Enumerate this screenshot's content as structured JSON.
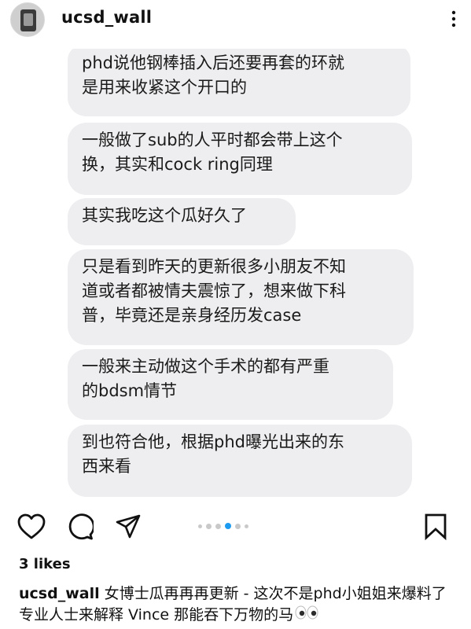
{
  "header": {
    "username": "ucsd_wall",
    "more_icon": "more-vertical-icon"
  },
  "post": {
    "messages": [
      {
        "text_line1": "phd说他钢棒插入后还要再套的环就",
        "text_line2": "是用来收紧这个开口的"
      },
      {
        "text_line1": "一般做了sub的人平时都会带上这个",
        "text_line2": "换，其实和cock ring同理"
      },
      {
        "text_line1": "其实我吃这个瓜好久了",
        "text_line2": ""
      },
      {
        "text_line1": "只是看到昨天的更新很多小朋友不知",
        "text_line2": "道或者都被情夫震惊了，想来做下科",
        "text_line3": "普，毕竟还是亲身经历发case"
      },
      {
        "text_line1": "一般来主动做这个手术的都有严重",
        "text_line2": "的bdsm情节"
      },
      {
        "text_line1": "到也符合他，根据phd曝光出来的东",
        "text_line2": "西来看"
      }
    ]
  },
  "actions": {
    "like_icon": "heart-icon",
    "comment_icon": "comment-icon",
    "share_icon": "send-icon",
    "save_icon": "bookmark-icon",
    "carousel_total": 6,
    "carousel_active": 4
  },
  "likes": {
    "text": "3 likes"
  },
  "caption": {
    "username": "ucsd_wall",
    "text": "女博士瓜再再再更新 - 这次不是phd小姐姐来爆料了 专业人士来解释 Vince 那能吞下万物的马",
    "emoji_icon": "eyes-emoji-icon"
  },
  "colors": {
    "bubble_bg": "#eeeef0",
    "active_dot": "#1d9bf0",
    "inactive_dot": "#c9c9c9"
  }
}
